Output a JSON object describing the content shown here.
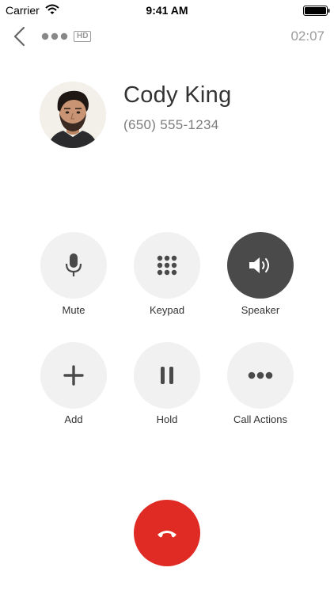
{
  "status_bar": {
    "carrier": "Carrier",
    "time": "9:41 AM"
  },
  "header": {
    "hd_badge": "HD",
    "call_timer": "02:07"
  },
  "contact": {
    "name": "Cody King",
    "phone": "(650) 555-1234"
  },
  "actions": [
    {
      "label": "Mute",
      "icon": "microphone-icon",
      "active": false
    },
    {
      "label": "Keypad",
      "icon": "keypad-icon",
      "active": false
    },
    {
      "label": "Speaker",
      "icon": "speaker-icon",
      "active": true
    },
    {
      "label": "Add",
      "icon": "plus-icon",
      "active": false
    },
    {
      "label": "Hold",
      "icon": "pause-icon",
      "active": false
    },
    {
      "label": "Call Actions",
      "icon": "more-icon",
      "active": false
    }
  ],
  "end_call": {
    "icon": "hang-up-icon"
  },
  "colors": {
    "end_call": "#e02a24",
    "active_button": "#4a4a4a",
    "button": "#f1f1f1",
    "muted_text": "#9b9b9b"
  }
}
